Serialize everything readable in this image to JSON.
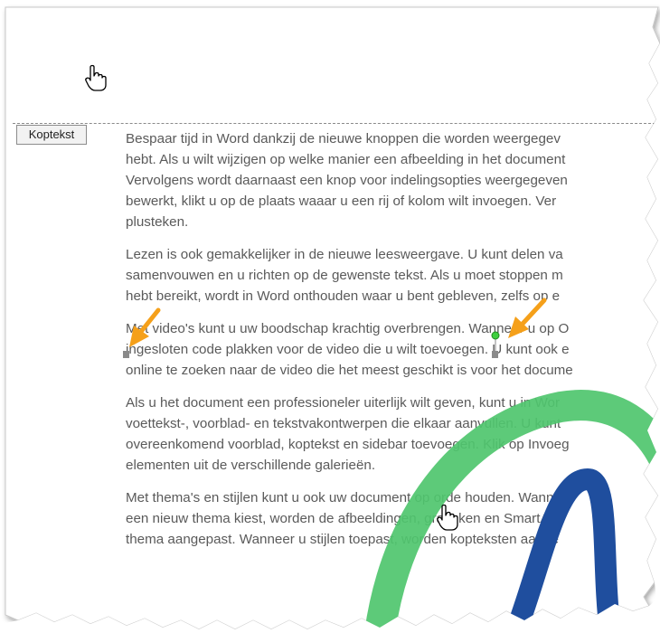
{
  "header_area": {
    "label": "Koptekst"
  },
  "document": {
    "paragraphs": [
      {
        "lines": [
          "Bespaar tijd in Word dankzij de nieuwe knoppen die worden weergegev",
          "hebt. Als u wilt wijzigen op welke manier een afbeelding in het document",
          "Vervolgens wordt daarnaast een knop voor indelingsopties weergegeven",
          "bewerkt, klikt u op de plaats waaar u een rij of kolom wilt invoegen. Ver",
          "plusteken."
        ]
      },
      {
        "lines": [
          "Lezen is ook gemakkelijker in de nieuwe leesweergave. U kunt delen va",
          "samenvouwen en u richten op de gewenste tekst. Als u moet stoppen m",
          "hebt bereikt, wordt in Word onthouden waar u bent gebleven, zelfs op e"
        ]
      },
      {
        "lines": [
          "Met video's kunt u uw boodschap krachtig overbrengen. Wanneer u op O",
          "ingesloten code plakken voor de video die u wilt toevoegen. U kunt ook e",
          "online te zoeken naar de video die het meest geschikt is voor het docume"
        ]
      },
      {
        "lines": [
          "Als u het document een professioneler uiterlijk wilt geven, kunt u in Wor",
          "voettekst-, voorblad- en tekstvakontwerpen die elkaar aanvullen. U kunt",
          "overeenkomend voorblad, koptekst en sidebar toevoegen. Klik op Invoeg",
          "elementen uit de verschillende galerieën."
        ]
      },
      {
        "lines": [
          "Met thema's en stijlen kunt u ook uw document op orde houden. Wanne",
          "een nieuw thema kiest, worden de afbeeldingen, grafieken en SmartArt",
          "thema aangepast. Wanneer u stijlen toepast, worden kopteksten aange"
        ]
      }
    ]
  },
  "colors": {
    "page_background": "#ffffff",
    "body_text": "#5a5a5a",
    "dashed_line": "#8a8a8a",
    "callout_arrow": "#f5a01a",
    "green_shape": "#4fc66e",
    "blue_shape": "#1f4e9e",
    "rotation_handle": "#3ecf3e",
    "sizing_handle": "#8a8a8a"
  },
  "icons": {
    "cursor": "hand-pointer-icon",
    "arrow": "callout-arrow-icon",
    "handle": "sizing-handle-icon"
  }
}
